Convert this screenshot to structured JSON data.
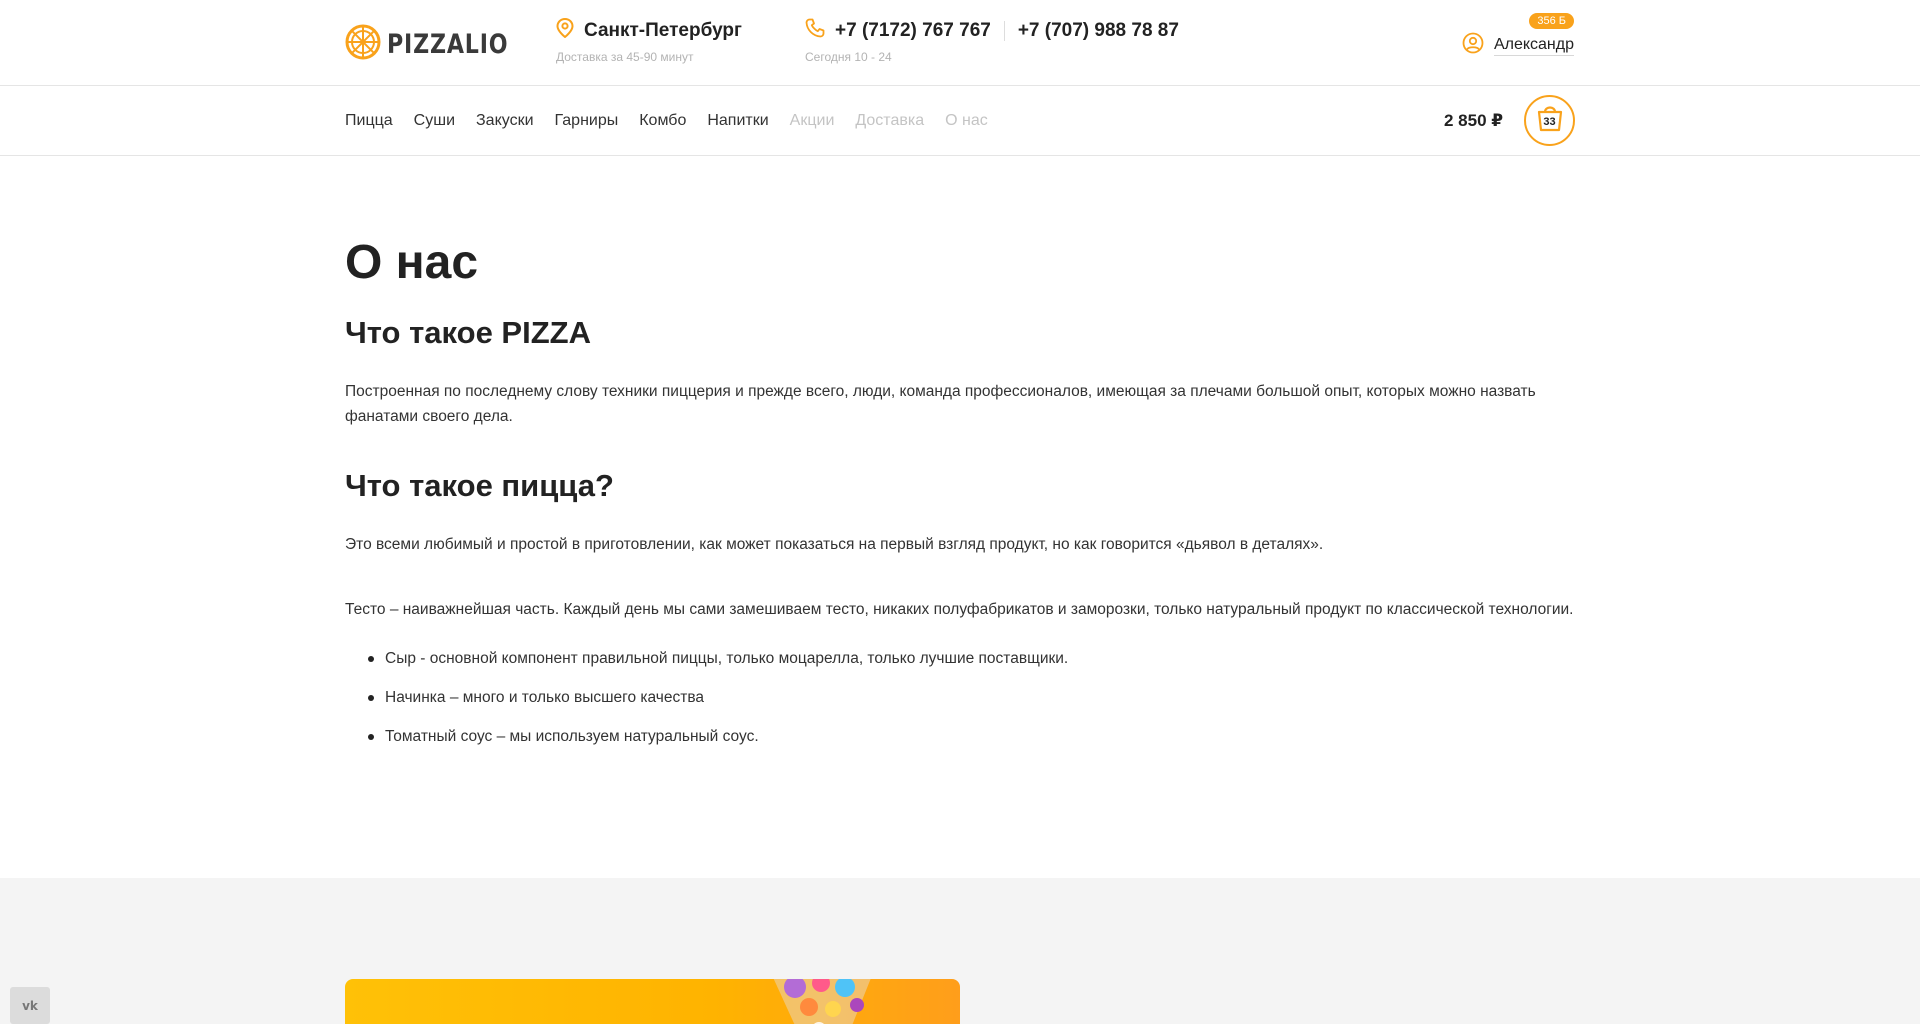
{
  "header": {
    "logo_text": "PIZZALIO",
    "city": "Санкт-Петербург",
    "delivery_note": "Доставка за 45-90 минут",
    "phones": [
      "+7 (7172) 767 767",
      "+7 (707) 988 78 87"
    ],
    "hours_note": "Сегодня 10 - 24",
    "user_name": "Александр",
    "bonus_badge": "356 Б"
  },
  "nav": {
    "items": [
      {
        "label": "Пицца"
      },
      {
        "label": "Суши"
      },
      {
        "label": "Закуски"
      },
      {
        "label": "Гарниры"
      },
      {
        "label": "Комбо"
      },
      {
        "label": "Напитки"
      },
      {
        "label": "Акции"
      },
      {
        "label": "Доставка"
      },
      {
        "label": "О нас"
      }
    ],
    "cart_total": "2 850 ₽",
    "cart_count": "33"
  },
  "content": {
    "page_title": "О нас",
    "section1_title": "Что такое PIZZA",
    "section1_text": "Построенная по последнему слову техники пиццерия и прежде всего, люди, команда профессионалов, имеющая за плечами большой опыт, которых можно назвать фанатами своего дела.",
    "section2_title": "Что такое пицца?",
    "section2_text": "Это всеми любимый и простой в приготовлении, как может показаться на первый взгляд продукт, но как говорится «дьявол в деталях».",
    "dough_text": "Тесто – наиважнейшая часть. Каждый день мы сами замешиваем тесто, никаких полуфабрикатов и заморозки, только натуральный продукт по классической технологии.",
    "list": [
      "Сыр - основной компонент правильной пиццы, только моцарелла, только лучшие поставщики.",
      "Начинка – много и только высшего качества",
      "Томатный соус – мы используем натуральный соус."
    ]
  },
  "social": {
    "vk_label": "vk"
  },
  "colors": {
    "accent": "#f9a21b",
    "text": "#222222",
    "muted": "#c4c4c4",
    "footer_bg": "#f4f4f4"
  },
  "icons": {
    "logo": "pizza-slice-icon",
    "city": "location-pin-icon",
    "phone": "phone-icon",
    "user": "user-circle-icon",
    "cart": "shopping-bag-icon",
    "social": "vk-icon"
  }
}
